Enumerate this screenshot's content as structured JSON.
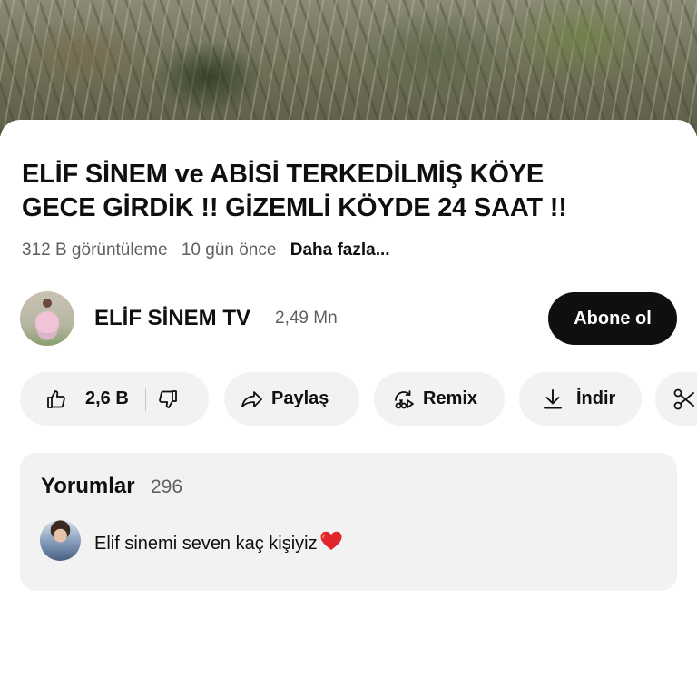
{
  "video": {
    "thumbnail_icon": "video-frame"
  },
  "title": {
    "line1": "ELİF SİNEM ve ABİSİ TERKEDİLMİŞ KÖYE",
    "line2": "GECE GİRDİK !! GİZEMLİ KÖYDE 24 SAAT !!"
  },
  "meta": {
    "views": "312 B görüntüleme",
    "age": "10 gün önce",
    "more": "Daha fazla..."
  },
  "channel": {
    "name": "ELİF SİNEM TV",
    "subscribers": "2,49 Mn",
    "subscribe_label": "Abone ol"
  },
  "actions": {
    "like_count": "2,6 B",
    "share_label": "Paylaş",
    "remix_label": "Remix",
    "download_label": "İndir"
  },
  "comments": {
    "heading": "Yorumlar",
    "count": "296",
    "top_comment": "Elif sinemi seven kaç kişiyiz",
    "heart_color": "#e0262b"
  }
}
